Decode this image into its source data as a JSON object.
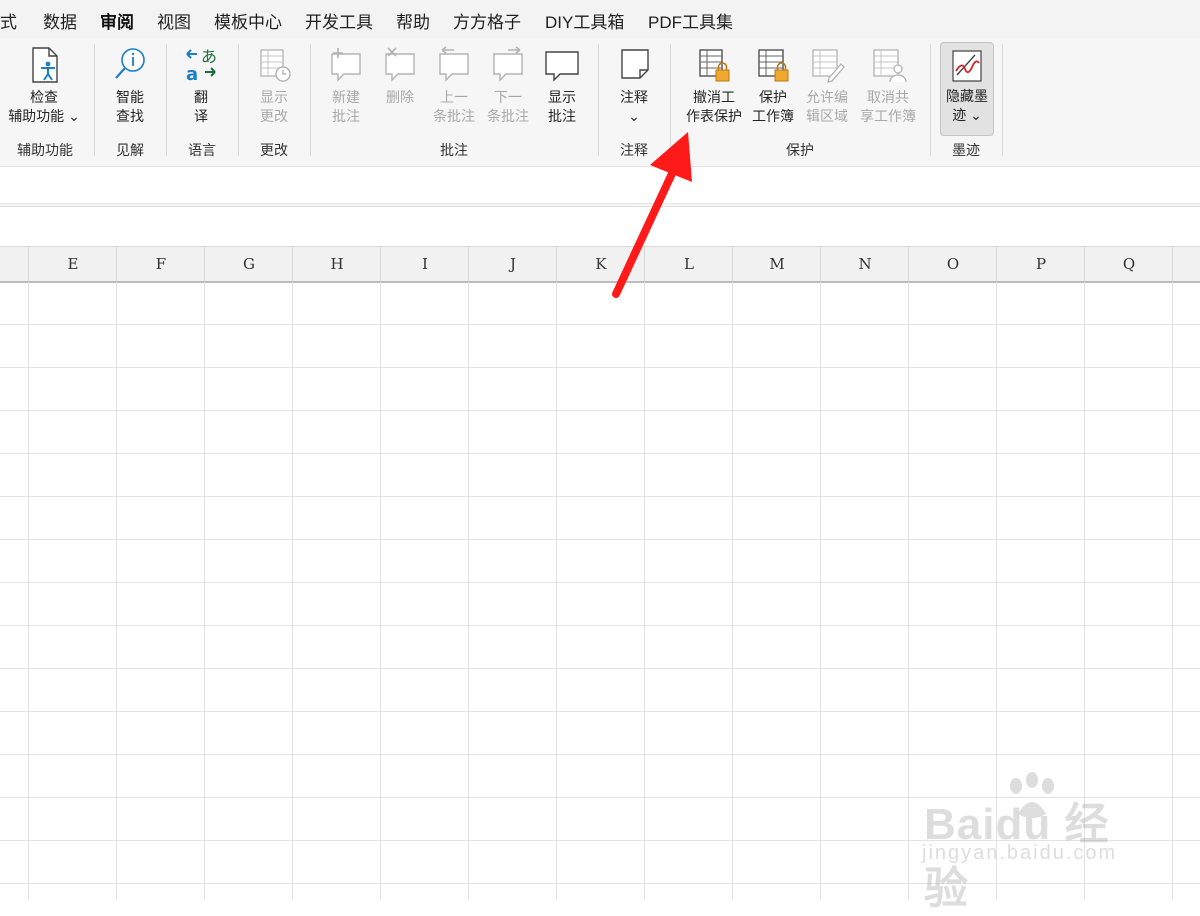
{
  "menu": {
    "items": [
      "式",
      "数据",
      "审阅",
      "视图",
      "模板中心",
      "开发工具",
      "帮助",
      "方方格子",
      "DIY工具箱",
      "PDF工具集"
    ],
    "active": "审阅"
  },
  "ribbon": {
    "check": {
      "line1": "检查",
      "line2": "辅助功能 ⌄"
    },
    "smart": {
      "line1": "智能",
      "line2": "查找"
    },
    "translate": {
      "line1": "翻",
      "line2": "译"
    },
    "show_changes": {
      "line1": "显示",
      "line2": "更改"
    },
    "new_comment": {
      "line1": "新建",
      "line2": "批注"
    },
    "delete": {
      "line1": "删除"
    },
    "prev_comment": {
      "line1": "上一",
      "line2": "条批注"
    },
    "next_comment": {
      "line1": "下一",
      "line2": "条批注"
    },
    "show_comments": {
      "line1": "显示",
      "line2": "批注"
    },
    "notes": {
      "line1": "注释",
      "line2": "⌄"
    },
    "unprotect_sheet": {
      "line1": "撤消工",
      "line2": "作表保护"
    },
    "protect_workbook": {
      "line1": "保护",
      "line2": "工作簿"
    },
    "allow_edit": {
      "line1": "允许编",
      "line2": "辑区域"
    },
    "unshare": {
      "line1": "取消共",
      "line2": "享工作簿"
    },
    "hide_ink": {
      "line1": "隐藏墨",
      "line2": "迹 ⌄"
    },
    "groups": {
      "accessibility": "辅助功能",
      "insights": "见解",
      "language": "语言",
      "changes": "更改",
      "comments": "批注",
      "notes": "注释",
      "protect": "保护",
      "ink": "墨迹"
    }
  },
  "columns": [
    "E",
    "F",
    "G",
    "H",
    "I",
    "J",
    "K",
    "L",
    "M",
    "N",
    "O",
    "P",
    "Q"
  ],
  "watermark": {
    "brand": "Bai",
    "brand2": "du",
    "cn": "经验",
    "url": "jingyan.baidu.com"
  },
  "colors": {
    "active_tab_underline": "#1e6e3c",
    "arrow": "#ff1a1a",
    "lock": "#f0a830"
  }
}
